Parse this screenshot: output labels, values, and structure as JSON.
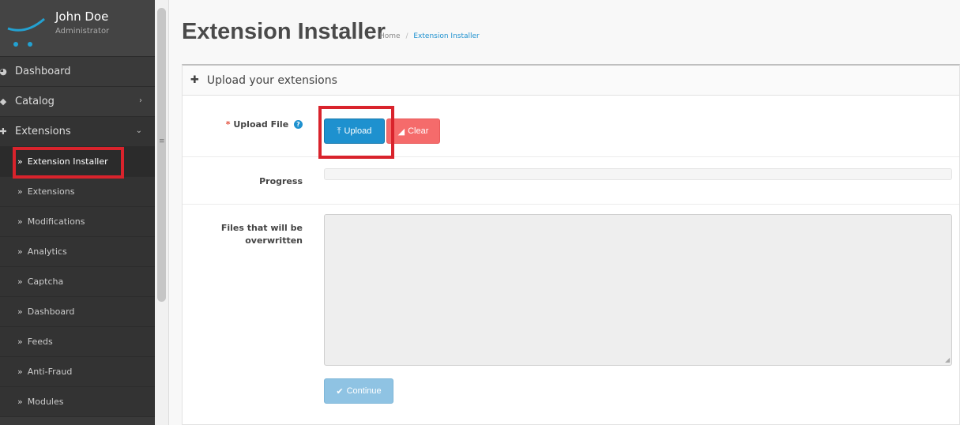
{
  "profile": {
    "name": "John Doe",
    "role": "Administrator"
  },
  "menu": {
    "dashboard": "Dashboard",
    "catalog": "Catalog",
    "extensions": "Extensions"
  },
  "submenu": [
    "Extension Installer",
    "Extensions",
    "Modifications",
    "Analytics",
    "Captcha",
    "Dashboard",
    "Feeds",
    "Anti-Fraud",
    "Modules"
  ],
  "page": {
    "title": "Extension Installer",
    "breadcrumb": [
      "Home",
      "Extension Installer"
    ]
  },
  "panel": {
    "heading": "Upload your extensions",
    "upload_label": "Upload File",
    "required_mark": "*",
    "upload_button": "Upload",
    "clear_button": "Clear",
    "progress_label": "Progress",
    "progress_value": 0,
    "overwrite_label_line1": "Files that will be",
    "overwrite_label_line2": "overwritten",
    "overwrite_value": "",
    "continue_button": "Continue"
  },
  "colors": {
    "primary": "#1e91cf",
    "danger": "#f56b6b",
    "highlight": "#d9232c",
    "sidebar": "#3a3a3a"
  }
}
